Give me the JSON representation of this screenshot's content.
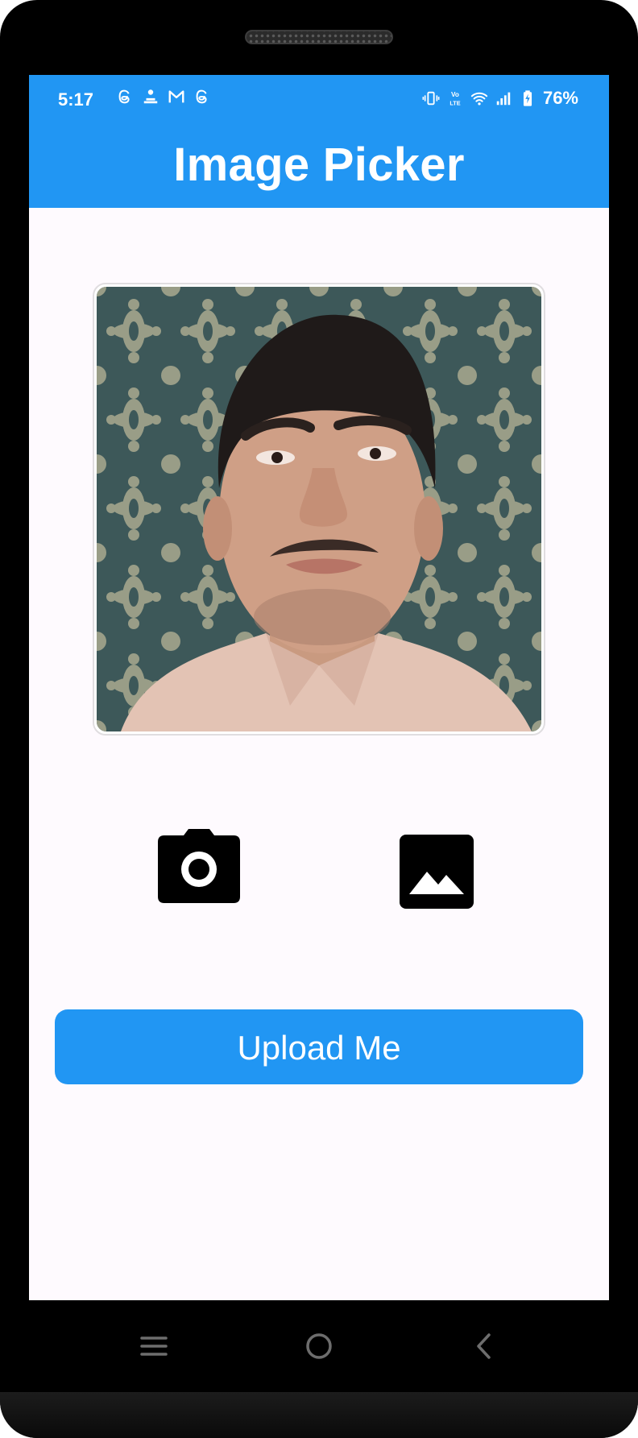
{
  "status_bar": {
    "time": "5:17",
    "battery_percent": "76%",
    "left_icons": [
      "threads-icon",
      "notification-app-icon",
      "gmail-icon",
      "threads-icon"
    ],
    "right_icons": [
      "vibrate-icon",
      "volte-icon",
      "wifi-icon",
      "signal-icon",
      "battery-charging-icon"
    ]
  },
  "app_bar": {
    "title": "Image Picker"
  },
  "main": {
    "photo_alt": "picked-photo",
    "camera_icon": "camera-icon",
    "gallery_icon": "image-icon",
    "upload_label": "Upload Me"
  },
  "nav_bar": {
    "items": [
      "recent-apps-icon",
      "home-icon",
      "back-icon"
    ]
  },
  "colors": {
    "primary": "#2196f3",
    "background": "#fefafe",
    "on_primary": "#ffffff"
  }
}
